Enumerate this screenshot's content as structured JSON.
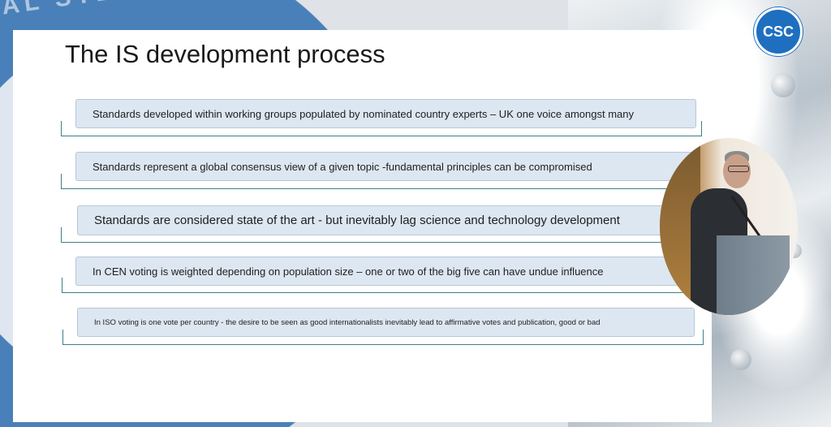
{
  "slide": {
    "title": "The IS development process",
    "items": [
      {
        "text": "Standards developed within working groups populated by nominated country experts – UK one voice amongst many"
      },
      {
        "text": "Standards represent a global consensus view of a given topic -fundamental principles can be compromised"
      },
      {
        "text": "Standards are considered state of the art - but inevitably lag science and technology development"
      },
      {
        "text": "In CEN voting is weighted depending on population size – one or two of the big five can have undue influence"
      },
      {
        "text": "In ISO voting is one vote per country - the desire to be seen as good internationalists inevitably lead to affirmative votes and publication, good or bad"
      }
    ]
  },
  "logo": {
    "text": "CSC",
    "color": "#1f6fc0"
  },
  "background": {
    "emblem_text": "AL STERILISING"
  },
  "colors": {
    "box_fill": "#dde7f2",
    "bracket": "#3d7f88"
  }
}
